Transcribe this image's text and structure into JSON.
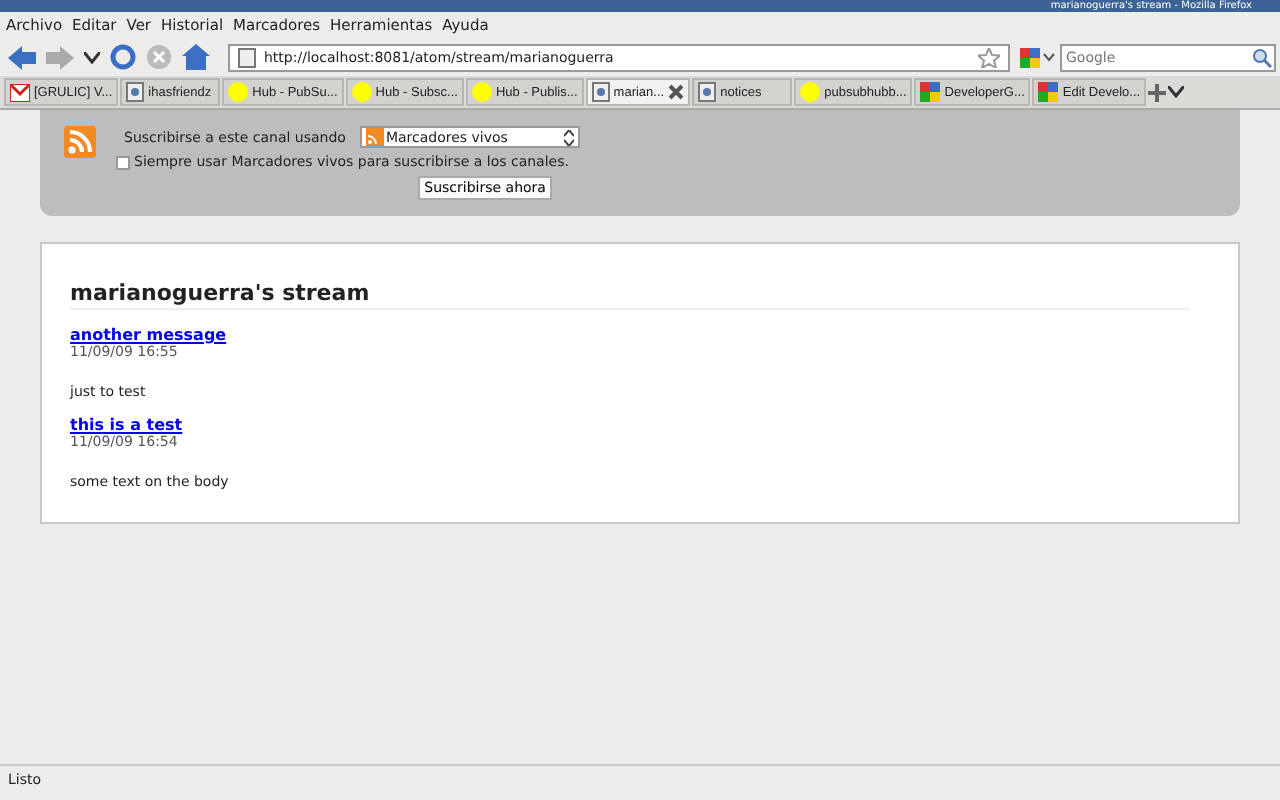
{
  "window": {
    "title": "marianoguerra's stream - Mozilla Firefox"
  },
  "menu": [
    "Archivo",
    "Editar",
    "Ver",
    "Historial",
    "Marcadores",
    "Herramientas",
    "Ayuda"
  ],
  "address": {
    "value": "http://localhost:8081/atom/stream/marianoguerra"
  },
  "search": {
    "placeholder": "Google"
  },
  "tabs": [
    {
      "label": "[GRULIC] V...",
      "selected": false,
      "kind": "mail"
    },
    {
      "label": "ihasfriendz",
      "selected": false,
      "kind": "page"
    },
    {
      "label": "Hub - PubSu...",
      "selected": false,
      "kind": "dot"
    },
    {
      "label": "Hub - Subsc...",
      "selected": false,
      "kind": "dot"
    },
    {
      "label": "Hub - Publis...",
      "selected": false,
      "kind": "dot"
    },
    {
      "label": "marian...",
      "selected": true,
      "kind": "page"
    },
    {
      "label": "notices",
      "selected": false,
      "kind": "page"
    },
    {
      "label": "pubsubhubb...",
      "selected": false,
      "kind": "dot"
    },
    {
      "label": "DeveloperG...",
      "selected": false,
      "kind": "google"
    },
    {
      "label": "Edit Develo...",
      "selected": false,
      "kind": "google"
    }
  ],
  "subscribe": {
    "label": "Suscribirse a este canal usando",
    "reader": "Marcadores vivos",
    "always": {
      "label": "Siempre usar Marcadores vivos para suscribirse a los canales.",
      "checked": false
    },
    "button": "Suscribirse ahora"
  },
  "stream": {
    "title": "marianoguerra's stream",
    "entries": [
      {
        "title": "another message",
        "date": "11/09/09 16:55",
        "body": "just to test"
      },
      {
        "title": "this is a test",
        "date": "11/09/09 16:54",
        "body": "some text on the body"
      }
    ]
  },
  "status_bar": "Listo"
}
